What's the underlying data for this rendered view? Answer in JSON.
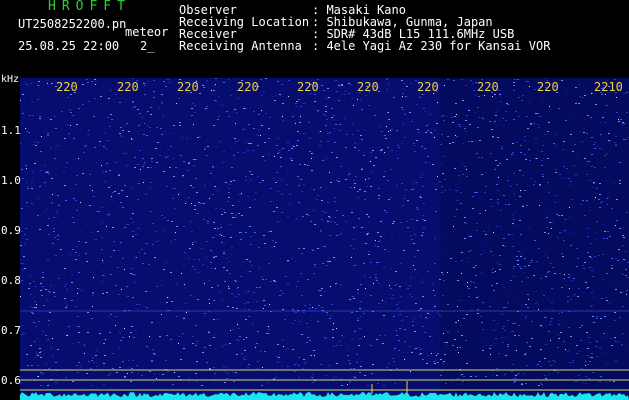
{
  "header": {
    "app_title": "HROFFT",
    "file_name": "UT2508252200.pn",
    "mode_label": "meteor",
    "date_time": "25.08.25 22:00",
    "count": "2_"
  },
  "info": [
    {
      "label": "Observer",
      "value": ": Masaki Kano"
    },
    {
      "label": "Receiving Location",
      "value": ": Shibukawa, Gunma, Japan"
    },
    {
      "label": "Receiver",
      "value": ": SDR# 43dB L15 111.6MHz USB"
    },
    {
      "label": "Receiving Antenna",
      "value": ": 4ele Yagi Az 230 for Kansai VOR"
    }
  ],
  "axes": {
    "y_unit": "kHz",
    "x_ticks": [
      "220",
      "220",
      "220",
      "220",
      "220",
      "220",
      "220",
      "220",
      "220",
      "2210"
    ],
    "y_ticks": [
      "1.1",
      "1.0",
      "0.9",
      "0.8",
      "0.7",
      "0.6"
    ]
  },
  "colors": {
    "background": "#000000",
    "spectrogram_base": "#060d6e",
    "tick_yellow": "#f2d23a",
    "title_green": "#2bd12b",
    "trace_cyan": "#19e6f0"
  }
}
